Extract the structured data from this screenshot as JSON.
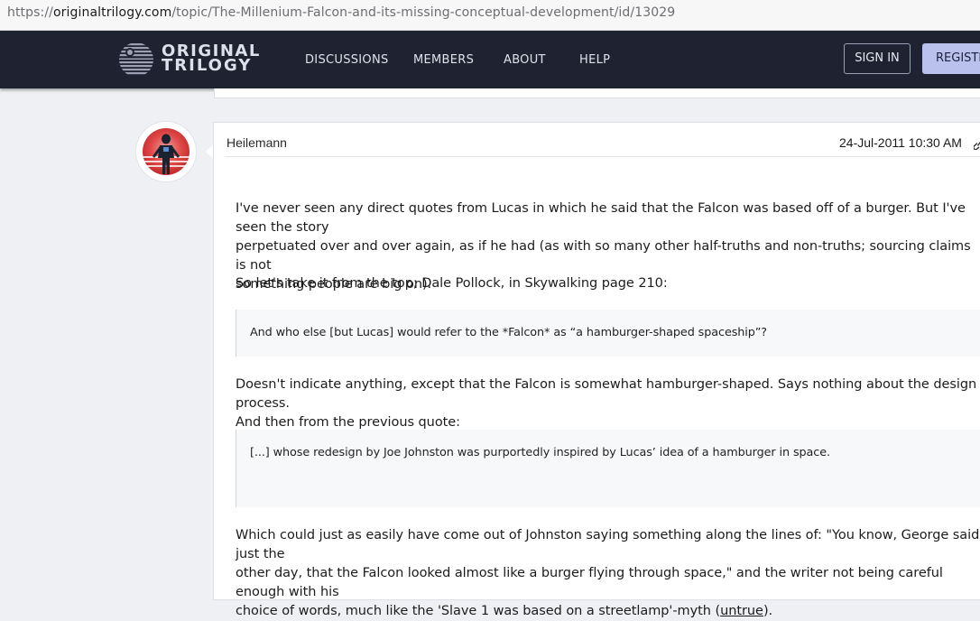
{
  "browser": {
    "url_prefix": "https://",
    "url_host": "originaltrilogy.com",
    "url_path": "/topic/The-Millenium-Falcon-and-its-missing-conceptual-development/id/13029"
  },
  "site": {
    "logo_line1": "ORIGINAL",
    "logo_line2": "TRILOGY",
    "nav": [
      "DISCUSSIONS",
      "MEMBERS",
      "ABOUT",
      "HELP"
    ],
    "sign_in": "SIGN IN",
    "register": "REGISTER"
  },
  "post": {
    "author": "Heilemann",
    "timestamp": "24-Jul-2011 10:30 AM",
    "p1_line1": "I've never seen any direct quotes from Lucas in which he said that the Falcon was based off of a burger. But I've seen the story",
    "p1_line2": "perpetuated over and over again, as if he had (as with so many other half-truths and non-truths; sourcing claims is not",
    "p1_line3": "something people are big on).",
    "p2": "So let's take it from the top; Dale Pollock, in Skywalking page 210:",
    "quote1": "And who else [but Lucas] would refer to the *Falcon* as “a hamburger-shaped spaceship”?",
    "p3_line1": " Doesn't indicate anything, except that the Falcon is somewhat hamburger-shaped. Says nothing about the design process.",
    "p3_line2": "And then from the previous quote:",
    "quote2": "[...] whose redesign by Joe Johnston was purportedly inspired by Lucas’ idea of a hamburger in space.",
    "p4_line1": "Which could just as easily have come out of Johnston saying something along the lines of: \"You know, George said just the",
    "p4_line2": "other day, that the Falcon looked almost like a burger flying through space,\" and the writer not being careful enough with his",
    "p4_line3_pre": "choice of words, much like the 'Slave 1 was based on a streetlamp'-myth (",
    "p4_link": "untrue",
    "p4_line3_post": ")."
  },
  "icons": {
    "logo": "death-star-logo-icon",
    "avatar": "character-avatar-icon",
    "permalink": "link-icon"
  },
  "colors": {
    "header_bg": "#1f2230",
    "register_bg": "#b9c1ec",
    "page_bg": "#eef0f3"
  }
}
